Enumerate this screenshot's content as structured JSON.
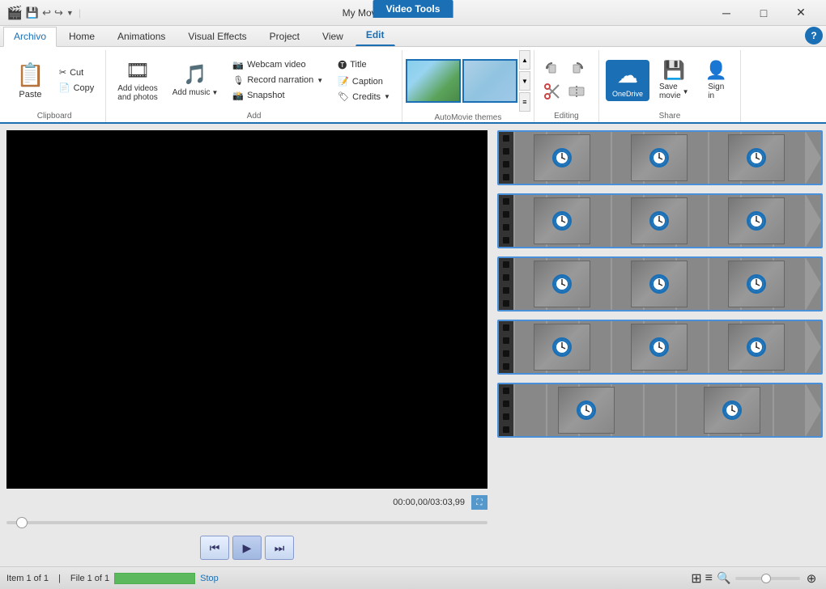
{
  "window": {
    "title": "My Movie - Movie Maker",
    "active_tab": "Video Tools"
  },
  "title_bar": {
    "icons": [
      "save-icon",
      "undo-icon",
      "redo-icon",
      "dropdown-icon"
    ],
    "title": "My Movie - Movie Maker",
    "btn_minimize": "─",
    "btn_restore": "□",
    "btn_close": "✕"
  },
  "quick_access": {
    "icons": [
      "💾",
      "↩",
      "↪",
      "▼"
    ]
  },
  "ribbon": {
    "video_tools_tab": "Video Tools",
    "tabs": [
      "Archivo",
      "Home",
      "Animations",
      "Visual Effects",
      "Project",
      "View",
      "Edit"
    ],
    "active_tab_index": 6,
    "highlighted_tab": "Video Tools",
    "groups": {
      "clipboard": {
        "label": "Clipboard",
        "paste_label": "Paste",
        "cut_label": "Cut",
        "copy_label": "Copy"
      },
      "add": {
        "label": "Add",
        "add_videos_label": "Add videos\nand photos",
        "add_music_label": "Add\nmusic",
        "webcam_label": "Webcam video",
        "narration_label": "Record narration",
        "snapshot_label": "Snapshot",
        "title_label": "Title",
        "caption_label": "Caption",
        "credits_label": "Credits"
      },
      "automovie": {
        "label": "AutoMovie themes",
        "themes": [
          "nature-theme",
          "gray-theme"
        ]
      },
      "editing": {
        "label": "Editing",
        "rotate_left_label": "↺",
        "rotate_right_label": "↻",
        "trim_label": "✂",
        "split_label": "⚡"
      },
      "share": {
        "label": "Share",
        "onedrive_label": "OneDrive",
        "save_movie_label": "Save\nmovie",
        "sign_in_label": "Sign\nin"
      }
    }
  },
  "preview": {
    "time_display": "00:00,00/03:03,99",
    "play_back_btn": "⏮",
    "play_btn": "▶",
    "play_fwd_btn": "⏭"
  },
  "timeline": {
    "strips": [
      {
        "id": 1,
        "frames": 3
      },
      {
        "id": 2,
        "frames": 3
      },
      {
        "id": 3,
        "frames": 3
      },
      {
        "id": 4,
        "frames": 3
      },
      {
        "id": 5,
        "frames": 2
      }
    ]
  },
  "status_bar": {
    "item_count": "Item 1 of 1",
    "file_count": "File 1 of 1",
    "stop_label": "Stop",
    "zoom_minus": "🔍",
    "zoom_plus": "🔍"
  }
}
